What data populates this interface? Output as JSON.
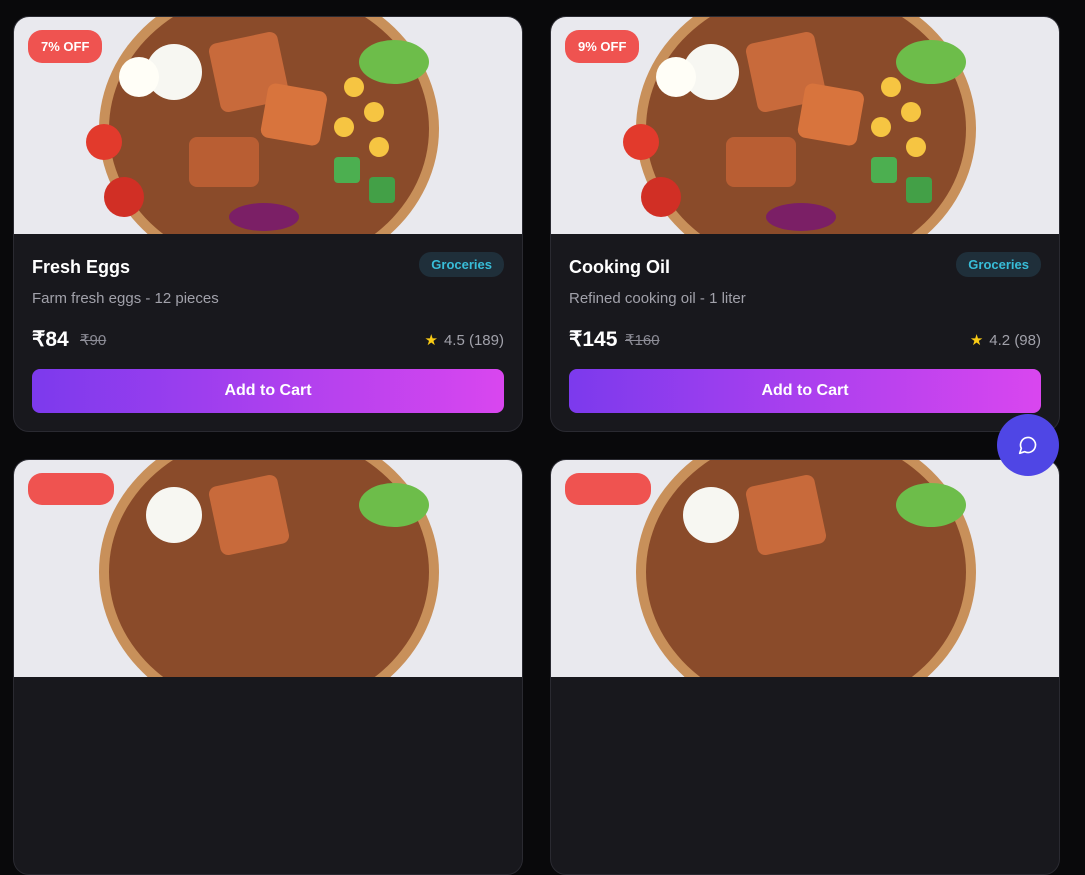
{
  "products": [
    {
      "discount": "7% OFF",
      "title": "Fresh Eggs",
      "category": "Groceries",
      "description": "Farm fresh eggs - 12 pieces",
      "price": "₹84",
      "old_price": "₹90",
      "rating": "4.5 (189)",
      "cta": "Add to Cart"
    },
    {
      "discount": "9% OFF",
      "title": "Cooking Oil",
      "category": "Groceries",
      "description": "Refined cooking oil - 1 liter",
      "price": "₹145",
      "old_price": "₹160",
      "rating": "4.2 (98)",
      "cta": "Add to Cart"
    }
  ],
  "colors": {
    "accent_from": "#7c3aed",
    "accent_to": "#d946ef",
    "badge": "#ef5350",
    "chat": "#4f46e5"
  },
  "chat_icon": "chat-bubble-icon"
}
